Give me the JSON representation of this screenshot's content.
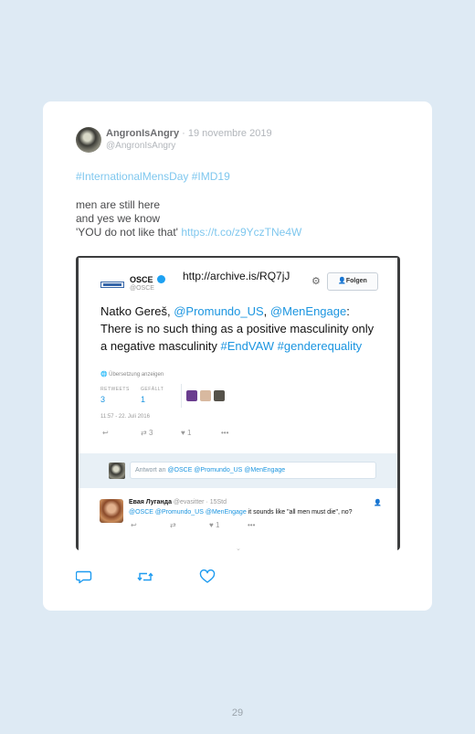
{
  "tweet": {
    "author": "AngronIsAngry",
    "date": " · 19 novembre 2019",
    "handle": "@AngronIsAngry",
    "hashtags": "#InternationalMensDay #IMD19",
    "lines": [
      "men are still here",
      "and yes we know",
      "'YOU do not like that' "
    ],
    "link": "https://t.co/z9YczTNe4W"
  },
  "embedded": {
    "org_name": "OSCE",
    "org_handle": "@OSCE",
    "archive_url": "http://archive.is/RQ7jJ",
    "follow_label": "Folgen",
    "quote": {
      "prefix": "Natko Gereš, ",
      "mention1": "@Promundo_US",
      "comma": ",",
      "mention2": "@MenEngage",
      "text": ": There is no such thing as a positive masculinity only a negative masculinity ",
      "tag1": "#EndVAW",
      "tag2": " #genderequality"
    },
    "translate": "Übersetzung anzeigen",
    "retweets_label": "RETWEETS",
    "retweets": "3",
    "likes_label": "GEFÄLLT",
    "likes": "1",
    "timestamp": "11:57 - 22. Juli 2016",
    "action_retweet_count": "3",
    "action_like_count": "1",
    "reply_prefix": "Antwort an ",
    "reply_mentions": "@OSCE @Promundo_US @MenEngage",
    "reply": {
      "name": "Евая Луганда",
      "meta": " @evasitter · 15Std",
      "mentions": "@OSCE @Promundo_US @MenEngage",
      "text": " it sounds like \"all men must die\", no?",
      "like_count": "1"
    }
  },
  "page_number": "29",
  "colors": {
    "background": "#deeaf4",
    "link": "#7fc7ee",
    "card": "#ffffff"
  }
}
